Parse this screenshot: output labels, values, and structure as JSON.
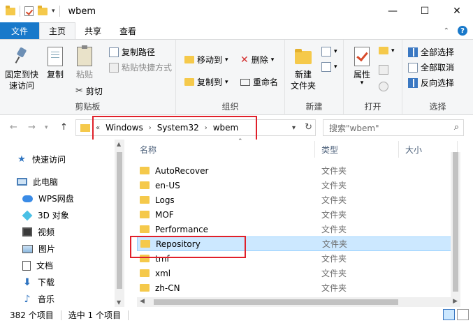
{
  "window": {
    "title": "wbem",
    "controls": {
      "minimize": "—",
      "maximize": "☐",
      "close": "✕"
    }
  },
  "tabs": [
    {
      "label": "文件"
    },
    {
      "label": "主页"
    },
    {
      "label": "共享"
    },
    {
      "label": "查看"
    }
  ],
  "ribbon": {
    "clipboard": {
      "label": "剪贴板",
      "pin": "固定到快\n速访问",
      "pin_l1": "固定到快",
      "pin_l2": "速访问",
      "copy": "复制",
      "paste": "粘贴",
      "copy_path": "复制路径",
      "paste_shortcut": "粘贴快捷方式",
      "cut": "剪切"
    },
    "organize": {
      "label": "组织",
      "move_to": "移动到",
      "copy_to": "复制到",
      "delete": "删除",
      "rename": "重命名"
    },
    "new": {
      "label": "新建",
      "new_folder_l1": "新建",
      "new_folder_l2": "文件夹"
    },
    "open": {
      "label": "打开",
      "properties": "属性"
    },
    "select": {
      "label": "选择",
      "select_all": "全部选择",
      "select_none": "全部取消",
      "invert": "反向选择"
    }
  },
  "address": {
    "crumbs": [
      "Windows",
      "System32",
      "wbem"
    ],
    "search_placeholder": "搜索\"wbem\""
  },
  "nav": {
    "items": [
      {
        "label": "快速访问",
        "icon": "star-icon"
      },
      {
        "label": "此电脑",
        "icon": "computer-icon"
      },
      {
        "label": "WPS网盘",
        "icon": "cloud-icon"
      },
      {
        "label": "3D 对象",
        "icon": "cube-icon"
      },
      {
        "label": "视频",
        "icon": "video-icon"
      },
      {
        "label": "图片",
        "icon": "picture-icon"
      },
      {
        "label": "文档",
        "icon": "document-icon"
      },
      {
        "label": "下载",
        "icon": "download-icon"
      },
      {
        "label": "音乐",
        "icon": "music-icon"
      }
    ]
  },
  "columns": {
    "name": "名称",
    "type": "类型",
    "size": "大小"
  },
  "files": [
    {
      "name": "AutoRecover",
      "type": "文件夹"
    },
    {
      "name": "en-US",
      "type": "文件夹"
    },
    {
      "name": "Logs",
      "type": "文件夹"
    },
    {
      "name": "MOF",
      "type": "文件夹"
    },
    {
      "name": "Performance",
      "type": "文件夹"
    },
    {
      "name": "Repository",
      "type": "文件夹"
    },
    {
      "name": "tmf",
      "type": "文件夹"
    },
    {
      "name": "xml",
      "type": "文件夹"
    },
    {
      "name": "zh-CN",
      "type": "文件夹"
    }
  ],
  "status": {
    "count": "382 个项目",
    "selected": "选中 1 个项目"
  },
  "colors": {
    "accent": "#1979ca",
    "highlight": "#e0202a",
    "selection": "#cce8ff"
  }
}
